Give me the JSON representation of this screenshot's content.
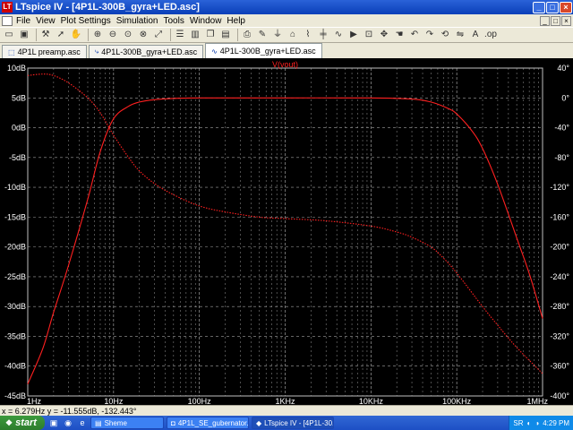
{
  "window": {
    "app_icon_text": "LT",
    "title": "LTspice IV - [4P1L-300B_gyra+LED.asc]",
    "minimize": "_",
    "maximize": "□",
    "close": "×"
  },
  "menu": {
    "items": [
      "File",
      "View",
      "Plot Settings",
      "Simulation",
      "Tools",
      "Window",
      "Help"
    ],
    "doc_buttons": [
      "_",
      "□",
      "×"
    ]
  },
  "toolbar": {
    "icons": [
      "open-icon",
      "save-icon",
      "control-panel-icon",
      "run-icon",
      "halt-icon",
      "zoom-in-icon",
      "zoom-out-icon",
      "zoom-area-icon",
      "zoom-fit-icon",
      "autorange-icon",
      "tile-horizontal-icon",
      "tile-vertical-icon",
      "cascade-icon",
      "close-window-icon",
      "print-icon",
      "wire-icon",
      "ground-icon",
      "label-icon",
      "resistor-icon",
      "capacitor-icon",
      "inductor-icon",
      "diode-icon",
      "component-icon",
      "move-icon",
      "drag-icon",
      "undo-icon",
      "redo-icon",
      "rotate-icon",
      "mirror-icon",
      "text-icon",
      "spice-directive-icon"
    ]
  },
  "tabs": [
    {
      "label": "4P1L preamp.asc",
      "active": false
    },
    {
      "label": "4P1L-300B_gyra+LED.asc",
      "active": false
    },
    {
      "label": "4P1L-300B_gyra+LED.asc",
      "active": true
    }
  ],
  "status": {
    "readout": "x = 6.279Hz   y = -11.555dB, -132.443°"
  },
  "taskbar": {
    "start_label": "start",
    "tasks": [
      {
        "label": "Sheme",
        "active": false
      },
      {
        "label": "4P1L_SE_gubernator...",
        "active": false
      },
      {
        "label": "LTspice IV - [4P1L-30...",
        "active": true
      }
    ],
    "tray_lang": "SR",
    "clock": "4:29 PM"
  },
  "chart_data": {
    "type": "line",
    "title": "V(vout)",
    "xscale": "log",
    "xlim": [
      1,
      1000000
    ],
    "x_tick_labels": [
      "1Hz",
      "10Hz",
      "100Hz",
      "1KHz",
      "10KHz",
      "100KHz",
      "1MHz"
    ],
    "y_left_label": "dB",
    "ylim_left": [
      -45,
      10
    ],
    "y_left_tick_labels": [
      "10dB",
      "5dB",
      "0dB",
      "-5dB",
      "-10dB",
      "-15dB",
      "-20dB",
      "-25dB",
      "-30dB",
      "-35dB",
      "-40dB",
      "-45dB"
    ],
    "ylim_right": [
      -400,
      40
    ],
    "y_right_tick_labels": [
      "40°",
      "0°",
      "-40°",
      "-80°",
      "-120°",
      "-160°",
      "-200°",
      "-240°",
      "-280°",
      "-320°",
      "-360°",
      "-400°"
    ],
    "grid": true,
    "color": "#ff2020",
    "series": [
      {
        "axis": "left",
        "style": "solid",
        "x": [
          1,
          1.5,
          2,
          3,
          5,
          7,
          10,
          15,
          20,
          30,
          50,
          100,
          1000,
          10000,
          30000,
          50000,
          80000,
          100000,
          150000,
          200000,
          300000,
          500000,
          700000,
          1000000
        ],
        "y": [
          -43,
          -37,
          -31,
          -23,
          -12,
          -4,
          1.5,
          3.6,
          4.3,
          4.7,
          4.9,
          5.0,
          5.0,
          5.0,
          4.8,
          4.3,
          3.2,
          2.3,
          -0.5,
          -3.5,
          -9.5,
          -18.5,
          -24.5,
          -32
        ]
      },
      {
        "axis": "right",
        "style": "dotted",
        "x": [
          1,
          1.5,
          2,
          3,
          5,
          7,
          10,
          15,
          20,
          30,
          50,
          100,
          200,
          500,
          1000,
          3000,
          10000,
          20000,
          30000,
          50000,
          70000,
          100000,
          200000,
          300000,
          500000,
          1000000
        ],
        "y": [
          30,
          32,
          30,
          20,
          0,
          -20,
          -50,
          -80,
          -98,
          -115,
          -130,
          -145,
          -153,
          -160,
          -162,
          -165,
          -172,
          -180,
          -187,
          -200,
          -215,
          -235,
          -280,
          -305,
          -335,
          -370
        ]
      }
    ]
  }
}
